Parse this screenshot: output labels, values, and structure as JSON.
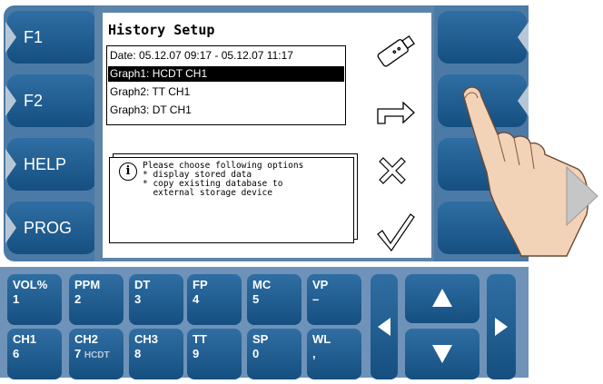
{
  "softkeys_left": [
    "F1",
    "F2",
    "HELP",
    "PROG"
  ],
  "screen": {
    "title": "History Setup",
    "list": [
      "Date: 05.12.07 09:17 - 05.12.07 11:17",
      "Graph1:  HCDT   CH1",
      "Graph2:  TT   CH1",
      "Graph3:  DT   CH1"
    ],
    "selected_index": 1,
    "message": "Please choose following options\n* display stored data\n* copy existing database to\n  external storage device",
    "info_icon_label": "i",
    "side_icons": [
      "usb-stick-icon",
      "return-arrow-icon",
      "cross-icon",
      "checkmark-icon"
    ]
  },
  "keypad": {
    "row1": [
      {
        "top": "VOL%",
        "bottom": "1"
      },
      {
        "top": "PPM",
        "bottom": "2"
      },
      {
        "top": "DT",
        "bottom": "3"
      },
      {
        "top": "FP",
        "bottom": "4"
      },
      {
        "top": "MC",
        "bottom": "5"
      },
      {
        "top": "VP",
        "bottom": "–"
      }
    ],
    "row2": [
      {
        "top": "CH1",
        "bottom": "6",
        "extra": ""
      },
      {
        "top": "CH2",
        "bottom": "7",
        "extra": "HCDT"
      },
      {
        "top": "CH3",
        "bottom": "8",
        "extra": ""
      },
      {
        "top": "TT",
        "bottom": "9",
        "extra": ""
      },
      {
        "top": "SP",
        "bottom": "0",
        "extra": ""
      },
      {
        "top": "WL",
        "bottom": ",",
        "extra": ""
      }
    ]
  },
  "colors": {
    "key_blue": "#1e5c92",
    "panel_blue": "#4b7aa6",
    "notch_grey": "#b8c7d6"
  }
}
